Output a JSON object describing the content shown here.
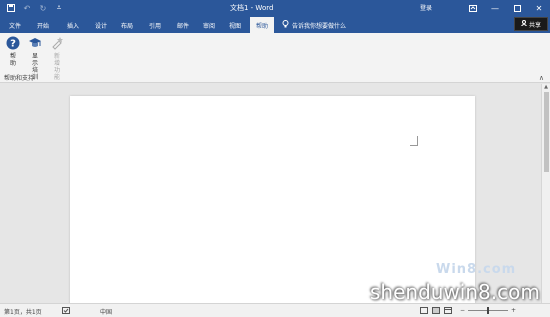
{
  "title_bar": {
    "document_title": "文档1 - Word",
    "login_label": "登录",
    "qat_icons": [
      "save-icon",
      "undo-icon",
      "redo-icon",
      "customize-qat-icon"
    ]
  },
  "tabs": [
    {
      "label": "文件",
      "active": false
    },
    {
      "label": "开始",
      "active": false
    },
    {
      "label": "插入",
      "active": false
    },
    {
      "label": "设计",
      "active": false
    },
    {
      "label": "布局",
      "active": false
    },
    {
      "label": "引用",
      "active": false
    },
    {
      "label": "邮件",
      "active": false
    },
    {
      "label": "审阅",
      "active": false
    },
    {
      "label": "视图",
      "active": false
    },
    {
      "label": "帮助",
      "active": true
    }
  ],
  "tell_me": {
    "placeholder": "告诉我你想要做什么"
  },
  "share": {
    "label": "共享"
  },
  "ribbon": {
    "buttons": [
      {
        "label": "帮助",
        "icon": "help-icon",
        "enabled": true
      },
      {
        "label": "显示培训",
        "icon": "training-icon",
        "enabled": true
      },
      {
        "label": "新增功能",
        "icon": "whats-new-icon",
        "enabled": false
      }
    ],
    "group_label": "帮助和支持"
  },
  "status_bar": {
    "page_info": "第1页，共1页",
    "language": "中国"
  },
  "watermark": {
    "small": "Win8.com",
    "main": "shenduwin8.com"
  },
  "colors": {
    "accent": "#2b579a",
    "ribbon_bg": "#f3f3f3",
    "workspace_bg": "#e6e6e6"
  }
}
